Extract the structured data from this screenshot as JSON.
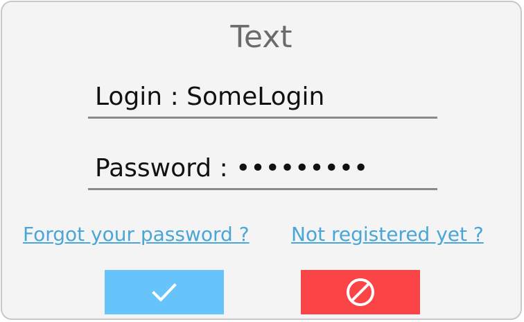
{
  "dialog": {
    "title": "Text"
  },
  "fields": {
    "login_text": "Login : SomeLogin",
    "password_text": "Password : •••••••••"
  },
  "links": {
    "forgot_password": "Forgot your password ?",
    "not_registered": "Not registered yet ?"
  },
  "buttons": {
    "confirm_icon": "checkmark-icon",
    "cancel_icon": "no-entry-icon"
  },
  "colors": {
    "background": "#f4f4f4",
    "title": "#6b6b6b",
    "link": "#49a6d6",
    "confirm": "#66c4fb",
    "cancel": "#fa4446",
    "field_underline": "#8a8a8a"
  }
}
